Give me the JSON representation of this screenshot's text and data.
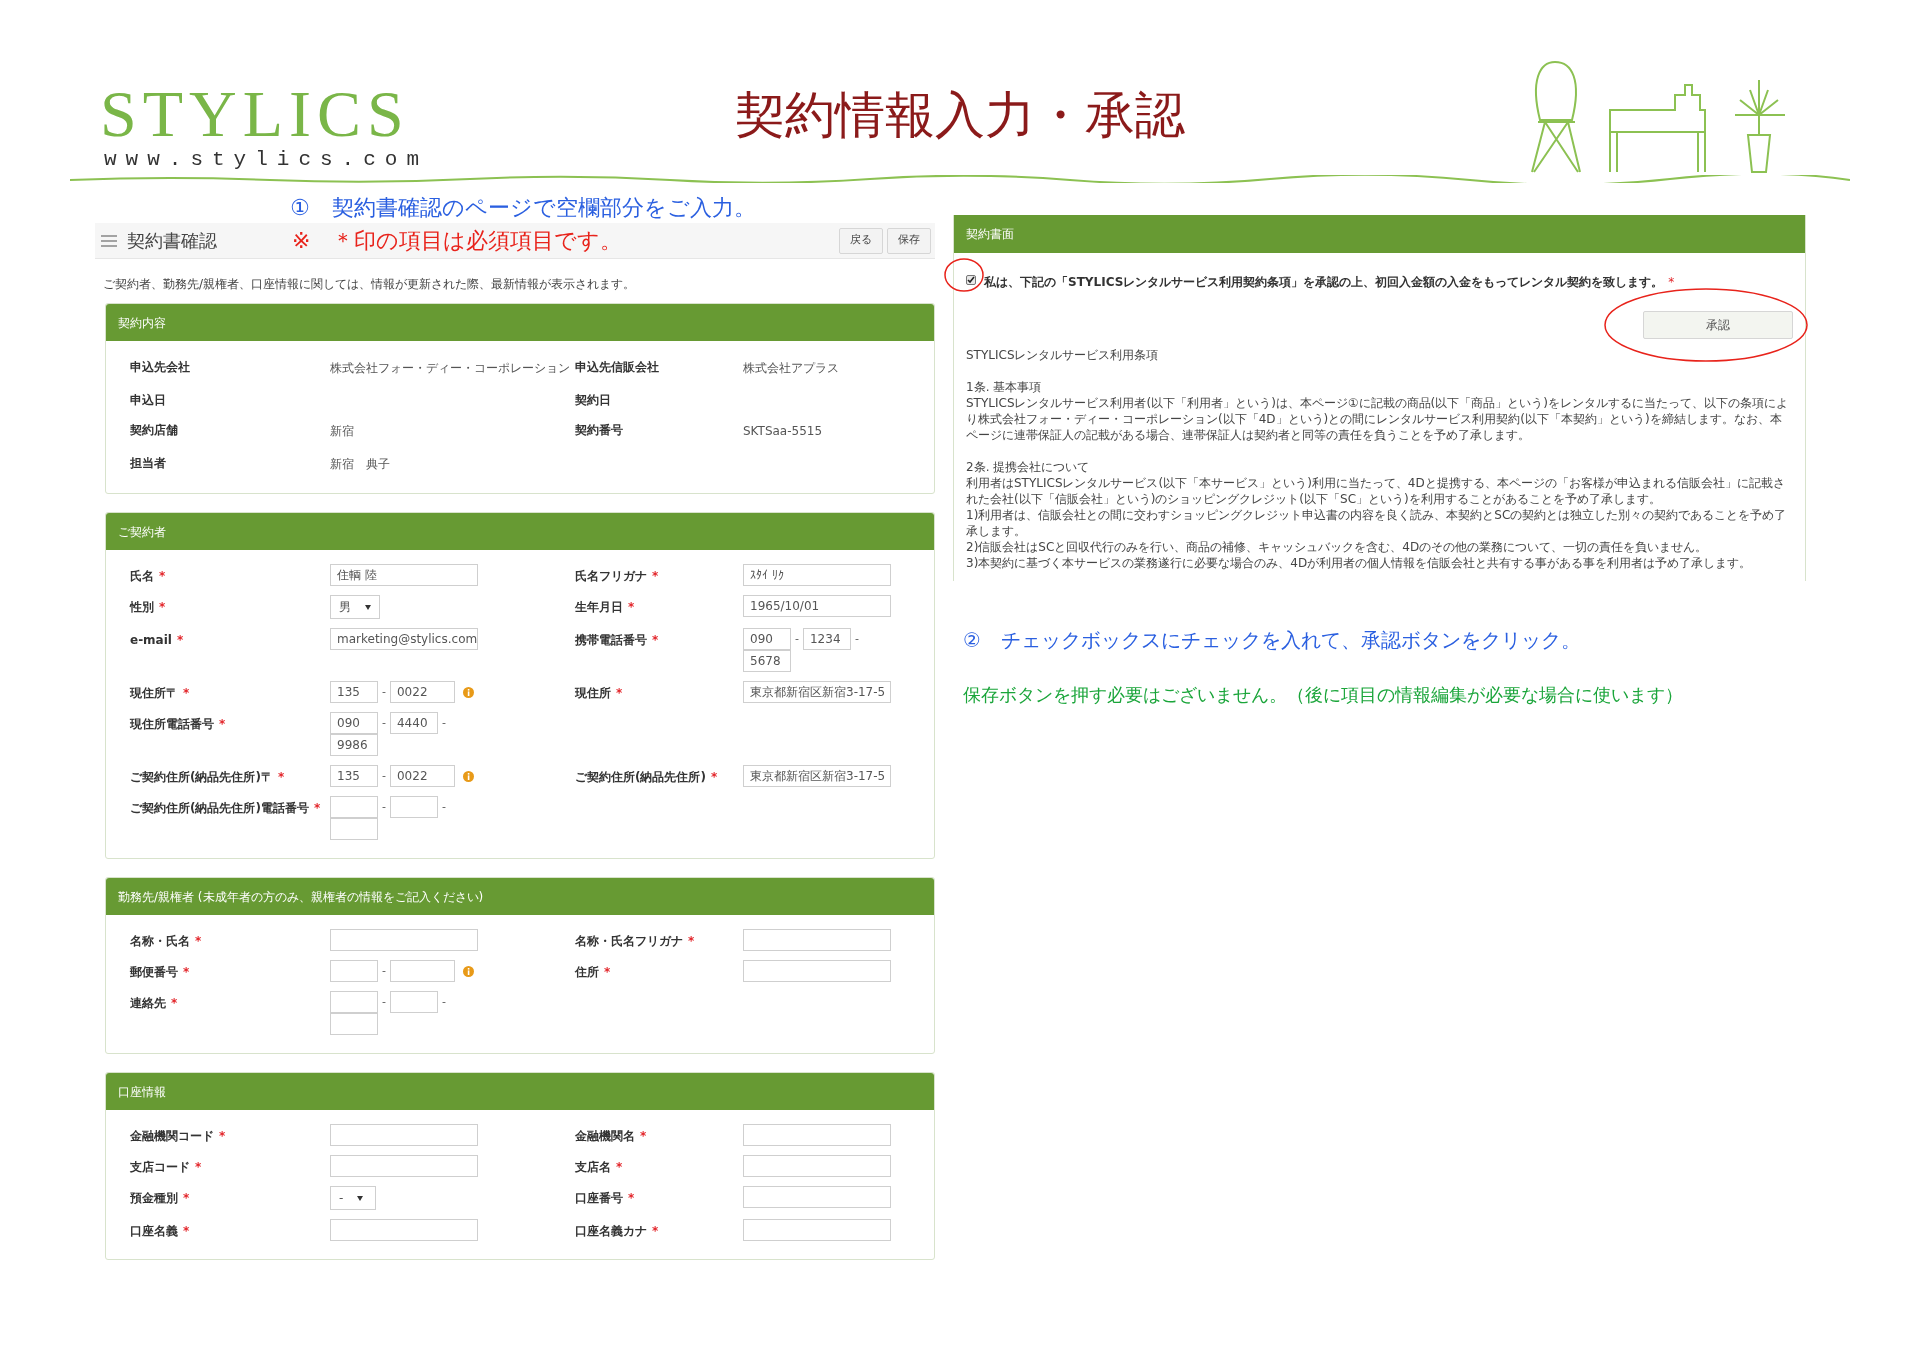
{
  "header": {
    "logo": "STYLICS",
    "logo_url": "www.stylics.com",
    "title": "契約情報入力・承認"
  },
  "annotations": {
    "step1": "①　契約書確認のページで空欄部分をご入力。",
    "required_note": "※　＊印の項目は必須項目です。",
    "step2": "②　チェックボックスにチェックを入れて、承認ボタンをクリック。",
    "save_note": "保存ボタンを押す必要はございません。（後に項目の情報編集が必要な場合に使います）"
  },
  "screen": {
    "title": "契約書確認",
    "buttons": [
      "戻る",
      "保存"
    ],
    "notice": "ご契約者、勤務先/親権者、口座情報に関しては、情報が更新された際、最新情報が表示されます。",
    "sections": [
      {
        "title": "契約内容",
        "rows": [
          [
            {
              "label": "申込先会社",
              "field": {
                "kind": "static",
                "value": "株式会社フォー・ディー・コーポレーション"
              }
            },
            {
              "label": "申込先信販会社",
              "field": {
                "kind": "static",
                "value": "株式会社アプラス"
              }
            }
          ],
          [
            {
              "label": "申込日"
            },
            {
              "label": "契約日"
            }
          ],
          [
            {
              "label": "契約店舗",
              "field": {
                "kind": "static",
                "value": "新宿"
              }
            },
            {
              "label": "契約番号",
              "field": {
                "kind": "static",
                "value": "SKTSaa-5515"
              }
            }
          ],
          [
            {
              "label": "担当者",
              "field": {
                "kind": "static",
                "value": "新宿　典子"
              }
            }
          ]
        ]
      },
      {
        "title": "ご契約者",
        "rows": [
          [
            {
              "label": "氏名",
              "required_mark": "*",
              "field": {
                "kind": "text",
                "value": "住輌 陸"
              }
            },
            {
              "label": "氏名フリガナ",
              "required_mark": "*",
              "field": {
                "kind": "text",
                "value": "ｽﾀｲ ﾘｸ"
              }
            }
          ],
          [
            {
              "label": "性別",
              "required_mark": "*",
              "field": {
                "kind": "select",
                "value": "男"
              }
            },
            {
              "label": "生年月日",
              "required_mark": "*",
              "field": {
                "kind": "text",
                "value": "1965/10/01"
              }
            }
          ],
          [
            {
              "label": "e-mail",
              "required_mark": "*",
              "field": {
                "kind": "text",
                "value": "marketing@stylics.com"
              }
            },
            {
              "label": "携帯電話番号",
              "required_mark": "*",
              "field": {
                "kind": "phone",
                "values": [
                  "090",
                  "1234",
                  "5678"
                ],
                "separators": [
                  "-",
                  "-"
                ]
              }
            }
          ],
          [
            {
              "label": "現住所〒",
              "required_mark": "*",
              "field": {
                "kind": "zip",
                "values": [
                  "135",
                  "0022"
                ],
                "separators": [
                  "-"
                ],
                "info": true
              }
            },
            {
              "label": "現住所",
              "required_mark": "*",
              "field": {
                "kind": "text",
                "value": "東京都新宿区新宿3-17-5"
              }
            }
          ],
          [
            {
              "label": "現住所電話番号",
              "required_mark": "*",
              "field": {
                "kind": "phone",
                "values": [
                  "090",
                  "4440",
                  "9986"
                ],
                "separators": [
                  "-",
                  "-"
                ]
              }
            }
          ],
          [
            {
              "label": "ご契約住所(納品先住所)〒",
              "required_mark": "*",
              "field": {
                "kind": "zip",
                "values": [
                  "135",
                  "0022"
                ],
                "separators": [
                  "-"
                ],
                "info": true
              }
            },
            {
              "label": "ご契約住所(納品先住所)",
              "required_mark": "*",
              "field": {
                "kind": "text",
                "value": "東京都新宿区新宿3-17-5"
              }
            }
          ],
          [
            {
              "label": "ご契約住所(納品先住所)電話番号",
              "required_mark": "*",
              "field": {
                "kind": "phone",
                "separators": [
                  "-",
                  "-"
                ]
              }
            }
          ]
        ]
      },
      {
        "title": "勤務先/親権者 (未成年者の方のみ、親権者の情報をご記入ください)",
        "rows": [
          [
            {
              "label": "名称・氏名",
              "required_mark": "*",
              "field": {
                "kind": "text"
              }
            },
            {
              "label": "名称・氏名フリガナ",
              "required_mark": "*",
              "field": {
                "kind": "text"
              }
            }
          ],
          [
            {
              "label": "郵便番号",
              "required_mark": "*",
              "field": {
                "kind": "zip",
                "separators": [
                  "-"
                ],
                "info": true
              }
            },
            {
              "label": "住所",
              "required_mark": "*",
              "field": {
                "kind": "text"
              }
            }
          ],
          [
            {
              "label": "連絡先",
              "required_mark": "*",
              "field": {
                "kind": "phone",
                "separators": [
                  "-",
                  "-"
                ]
              }
            }
          ]
        ]
      },
      {
        "title": "口座情報",
        "rows": [
          [
            {
              "label": "金融機関コード",
              "required_mark": "*",
              "field": {
                "kind": "text"
              }
            },
            {
              "label": "金融機関名",
              "required_mark": "*",
              "field": {
                "kind": "text"
              }
            }
          ],
          [
            {
              "label": "支店コード",
              "required_mark": "*",
              "field": {
                "kind": "text"
              }
            },
            {
              "label": "支店名",
              "required_mark": "*",
              "field": {
                "kind": "text"
              }
            }
          ],
          [
            {
              "label": "預金種別",
              "required_mark": "*",
              "field": {
                "kind": "select",
                "value": "-"
              }
            },
            {
              "label": "口座番号",
              "required_mark": "*",
              "field": {
                "kind": "text"
              }
            }
          ],
          [
            {
              "label": "口座名義",
              "required_mark": "*",
              "field": {
                "kind": "text"
              }
            },
            {
              "label": "口座名義カナ",
              "required_mark": "*",
              "field": {
                "kind": "text"
              }
            }
          ]
        ]
      }
    ]
  },
  "contract": {
    "title": "契約書面",
    "consent": {
      "checked": true,
      "circled": true,
      "text": "私は、下記の「STYLICSレンタルサービス利用契約条項」を承認の上、初回入金額の入金をもってレンタル契約を致します。",
      "required_mark": "*"
    },
    "approve_button": {
      "label": "承認",
      "circled": true
    },
    "terms": [
      {
        "lines": [
          "STYLICSレンタルサービス利用条項"
        ]
      },
      {
        "lines": [
          "1条. 基本事項",
          "STYLICSレンタルサービス利用者(以下「利用者」という)は、本ページ①に記載の商品(以下「商品」という)をレンタルするに当たって、以下の条項により株式会社フォー・ディー・コーポレーション(以下「4D」という)との間にレンタルサービス利用契約(以下「本契約」という)を締結します。なお、本ページに連帯保証人の記載がある場合、連帯保証人は契約者と同等の責任を負うことを予め了承します。"
        ]
      },
      {
        "lines": [
          "2条. 提携会社について",
          "利用者はSTYLICSレンタルサービス(以下「本サービス」という)利用に当たって、4Dと提携する、本ページの「お客様が申込まれる信販会社」に記載された会社(以下「信販会社」という)のショッピングクレジット(以下「SC」という)を利用することがあることを予め了承します。",
          "1)利用者は、信販会社との間に交わすショッピングクレジット申込書の内容を良く読み、本契約とSCの契約とは独立した別々の契約であることを予め了承します。",
          "2)信販会社はSCと回収代行のみを行い、商品の補修、キャッシュバックを含む、4Dのその他の業務について、一切の責任を負いません。",
          "3)本契約に基づく本サービスの業務遂行に必要な場合のみ、4Dが利用者の個人情報を信販会社と共有する事がある事を利用者は予め了承します。"
        ]
      }
    ]
  }
}
